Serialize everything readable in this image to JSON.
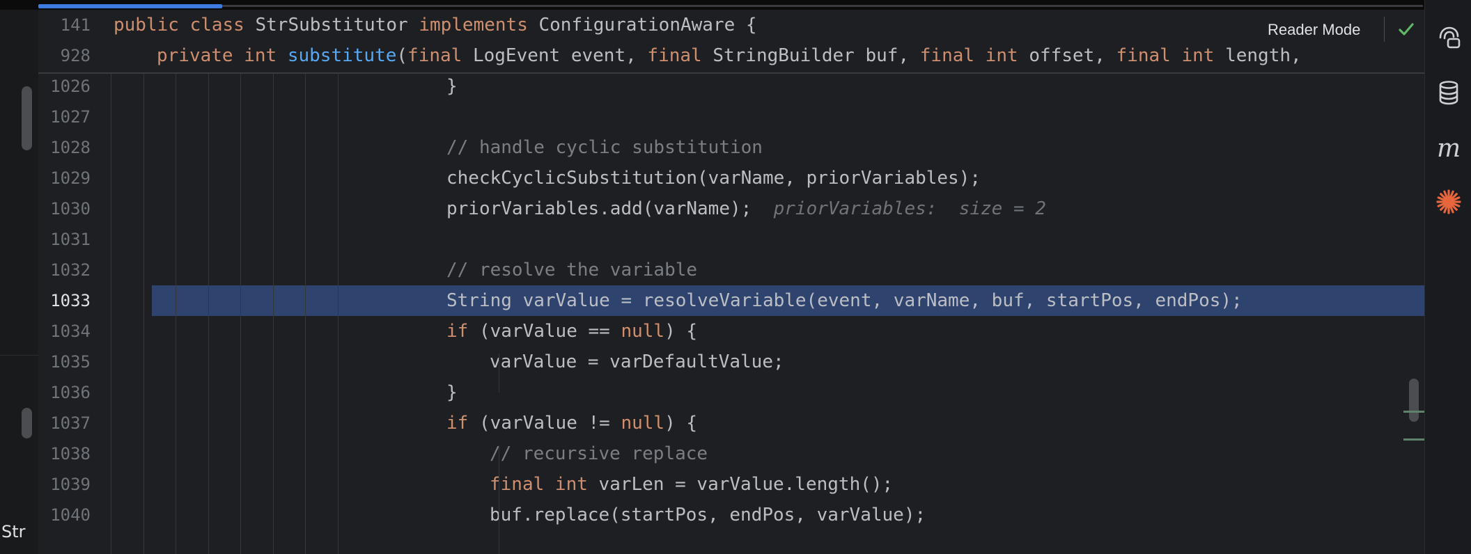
{
  "editor": {
    "reader_mode_label": "Reader Mode",
    "scroll_progress_fraction": 0.133,
    "sticky_lines": [
      {
        "number": "141",
        "indent": 0,
        "tokens": [
          [
            "kw",
            "public class "
          ],
          [
            "",
            "StrSubstitutor "
          ],
          [
            "kw",
            "implements "
          ],
          [
            "",
            "ConfigurationAware {"
          ]
        ]
      },
      {
        "number": "928",
        "indent": 1,
        "tokens": [
          [
            "kw",
            "private int "
          ],
          [
            "fn",
            "substitute"
          ],
          [
            "",
            "("
          ],
          [
            "kw",
            "final "
          ],
          [
            "",
            "LogEvent event, "
          ],
          [
            "kw",
            "final "
          ],
          [
            "",
            "StringBuilder buf, "
          ],
          [
            "kw",
            "final int "
          ],
          [
            "",
            "offset, "
          ],
          [
            "kw",
            "final int "
          ],
          [
            "",
            "length,"
          ]
        ]
      }
    ],
    "current_line": "1033",
    "lines": [
      {
        "number": "1026",
        "indent": 8,
        "tokens": [
          [
            "",
            "}"
          ]
        ]
      },
      {
        "number": "1027",
        "indent": 8,
        "tokens": []
      },
      {
        "number": "1028",
        "indent": 8,
        "tokens": [
          [
            "cm",
            "// handle cyclic substitution"
          ]
        ]
      },
      {
        "number": "1029",
        "indent": 8,
        "tokens": [
          [
            "",
            "checkCyclicSubstitution(varName, priorVariables);"
          ]
        ]
      },
      {
        "number": "1030",
        "indent": 8,
        "tokens": [
          [
            "",
            "priorVariables.add(varName);  "
          ],
          [
            "hint",
            "priorVariables:  size = 2"
          ]
        ]
      },
      {
        "number": "1031",
        "indent": 8,
        "tokens": []
      },
      {
        "number": "1032",
        "indent": 8,
        "tokens": [
          [
            "cm",
            "// resolve the variable"
          ]
        ]
      },
      {
        "number": "1033",
        "indent": 8,
        "tokens": [
          [
            "",
            "String varValue = resolveVariable(event, varName, buf, startPos, endPos);"
          ]
        ]
      },
      {
        "number": "1034",
        "indent": 8,
        "tokens": [
          [
            "kw",
            "if "
          ],
          [
            "",
            "(varValue == "
          ],
          [
            "kw",
            "null"
          ],
          [
            "",
            ") {"
          ]
        ]
      },
      {
        "number": "1035",
        "indent": 9,
        "tokens": [
          [
            "",
            "varValue = varDefaultValue;"
          ]
        ]
      },
      {
        "number": "1036",
        "indent": 8,
        "tokens": [
          [
            "",
            "}"
          ]
        ]
      },
      {
        "number": "1037",
        "indent": 8,
        "tokens": [
          [
            "kw",
            "if "
          ],
          [
            "",
            "(varValue != "
          ],
          [
            "kw",
            "null"
          ],
          [
            "",
            ") {"
          ]
        ]
      },
      {
        "number": "1038",
        "indent": 9,
        "tokens": [
          [
            "cm",
            "// recursive replace"
          ]
        ]
      },
      {
        "number": "1039",
        "indent": 9,
        "tokens": [
          [
            "kw",
            "final int "
          ],
          [
            "",
            "varLen = varValue.length();"
          ]
        ]
      },
      {
        "number": "1040",
        "indent": 9,
        "tokens": [
          [
            "",
            "buf.replace(startPos, endPos, varValue);"
          ]
        ]
      }
    ]
  },
  "left_panel": {
    "label": "Str"
  },
  "right_toolbar": {
    "items": [
      {
        "name": "ai-assistant-icon"
      },
      {
        "name": "database-icon"
      },
      {
        "name": "maven-icon"
      },
      {
        "name": "plugin-star-icon"
      }
    ]
  },
  "colors": {
    "accent": "#3d7be0",
    "keyword": "#cf8e6d",
    "function": "#56a8f5",
    "comment": "#7a7e85",
    "selection": "#2e436e",
    "success": "#5fb865",
    "tool_highlight": "#e8663d"
  }
}
